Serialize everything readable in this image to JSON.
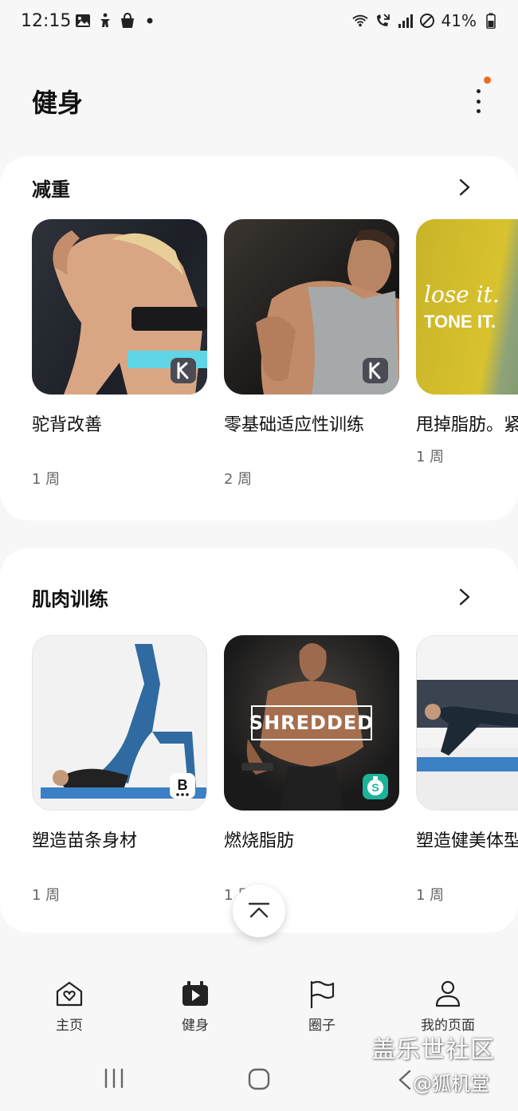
{
  "status_bar": {
    "time": "12:15",
    "battery": "41%",
    "left_icons": [
      "gallery-icon",
      "accessibility-icon",
      "shopping-bag-icon",
      "dot-icon"
    ],
    "right_icons": [
      "wifi-icon",
      "call-forward-icon",
      "signal-icon",
      "do-not-disturb-icon",
      "battery-icon"
    ]
  },
  "header": {
    "title": "健身",
    "menu_icon": "more-vert-icon",
    "notification_color": "#ef6a21"
  },
  "sections": [
    {
      "title": "减重",
      "items": [
        {
          "title": "驼背改善",
          "duration": "1 周",
          "badge": "k-icon"
        },
        {
          "title": "零基础适应性训练",
          "duration": "2 周",
          "badge": "k-icon"
        },
        {
          "title": "甩掉脂肪。紧实肌肉!",
          "duration": "1 周",
          "image_text": [
            "lose it.",
            "TONE IT."
          ]
        }
      ]
    },
    {
      "title": "肌肉训练",
      "items": [
        {
          "title": "塑造苗条身材",
          "duration": "1 周",
          "badge": "b-icon"
        },
        {
          "title": "燃烧脂肪",
          "duration": "1 周",
          "image_text": [
            "SHREDDED"
          ],
          "badge": "s-icon"
        },
        {
          "title": "塑造健美体型",
          "duration": "1 周"
        }
      ]
    }
  ],
  "bottom_nav": [
    {
      "label": "主页",
      "icon": "home-heart-icon"
    },
    {
      "label": "健身",
      "icon": "fitness-play-icon",
      "active": true
    },
    {
      "label": "圈子",
      "icon": "flag-icon"
    },
    {
      "label": "我的页面",
      "icon": "person-icon"
    }
  ],
  "watermark": {
    "line1": "盖乐世社区",
    "line2": "@狐机堂"
  }
}
